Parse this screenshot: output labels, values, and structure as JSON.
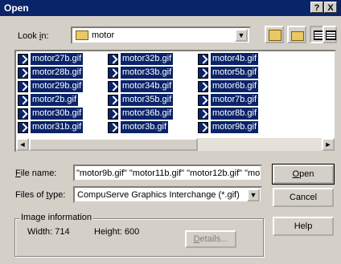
{
  "window": {
    "title": "Open",
    "help_btn": "?",
    "close_btn": "X"
  },
  "lookin": {
    "label_pre": "Look ",
    "label_u": "i",
    "label_post": "n:",
    "value": "motor"
  },
  "files": [
    [
      "motor27b.gif",
      "motor32b.gif",
      "motor4b.gif"
    ],
    [
      "motor28b.gif",
      "motor33b.gif",
      "motor5b.gif"
    ],
    [
      "motor29b.gif",
      "motor34b.gif",
      "motor6b.gif"
    ],
    [
      "motor2b.gif",
      "motor35b.gif",
      "motor7b.gif"
    ],
    [
      "motor30b.gif",
      "motor36b.gif",
      "motor8b.gif"
    ],
    [
      "motor31b.gif",
      "motor3b.gif",
      "motor9b.gif"
    ]
  ],
  "filename": {
    "label_u": "F",
    "label_post": "ile name:",
    "value": "\"motor9b.gif\" \"motor11b.gif\" \"motor12b.gif\" \"mo"
  },
  "filetype": {
    "label_pre": "Files of ",
    "label_u": "t",
    "label_post": "ype:",
    "value": "CompuServe Graphics Interchange (*.gif)"
  },
  "buttons": {
    "open_u": "O",
    "open_post": "pen",
    "cancel": "Cancel",
    "help": "Help",
    "details_u": "D",
    "details_post": "etails..."
  },
  "info": {
    "title": "Image information",
    "width": "Width: 714",
    "height": "Height: 600"
  }
}
